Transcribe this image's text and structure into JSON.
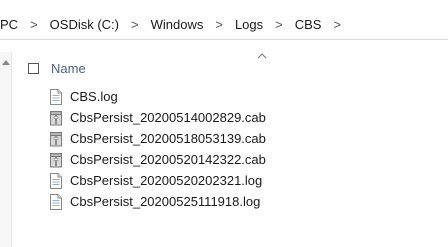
{
  "breadcrumb": {
    "items": [
      "PC",
      "OSDisk (C:)",
      "Windows",
      "Logs",
      "CBS"
    ],
    "separator": ">"
  },
  "header": {
    "name_label": "Name"
  },
  "files": [
    {
      "name": "CBS.log",
      "icon": "log-file-icon"
    },
    {
      "name": "CbsPersist_20200514002829.cab",
      "icon": "cab-archive-icon"
    },
    {
      "name": "CbsPersist_20200518053139.cab",
      "icon": "cab-archive-icon"
    },
    {
      "name": "CbsPersist_20200520142322.cab",
      "icon": "cab-archive-icon"
    },
    {
      "name": "CbsPersist_20200520202321.log",
      "icon": "log-file-icon"
    },
    {
      "name": "CbsPersist_20200525111918.log",
      "icon": "log-file-icon"
    }
  ],
  "colors": {
    "header_text": "#4c607a",
    "separator_line": "#d9d9d9"
  }
}
